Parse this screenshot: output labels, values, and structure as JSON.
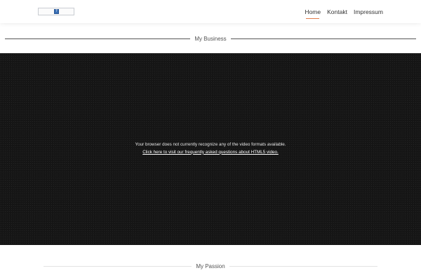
{
  "header": {
    "logo_icon_glyph": "?",
    "nav": [
      {
        "label": "Home",
        "active": true
      },
      {
        "label": "Kontakt",
        "active": false
      },
      {
        "label": "Impressum",
        "active": false
      }
    ],
    "accent_color": "#e07c4a"
  },
  "sections": {
    "business_title": "My Business",
    "passion_title": "My Passion"
  },
  "video": {
    "message": "Your browser does not currently recognize any of the video formats available.",
    "link_text": "Click here to visit our frequently asked questions about HTML5 video."
  }
}
